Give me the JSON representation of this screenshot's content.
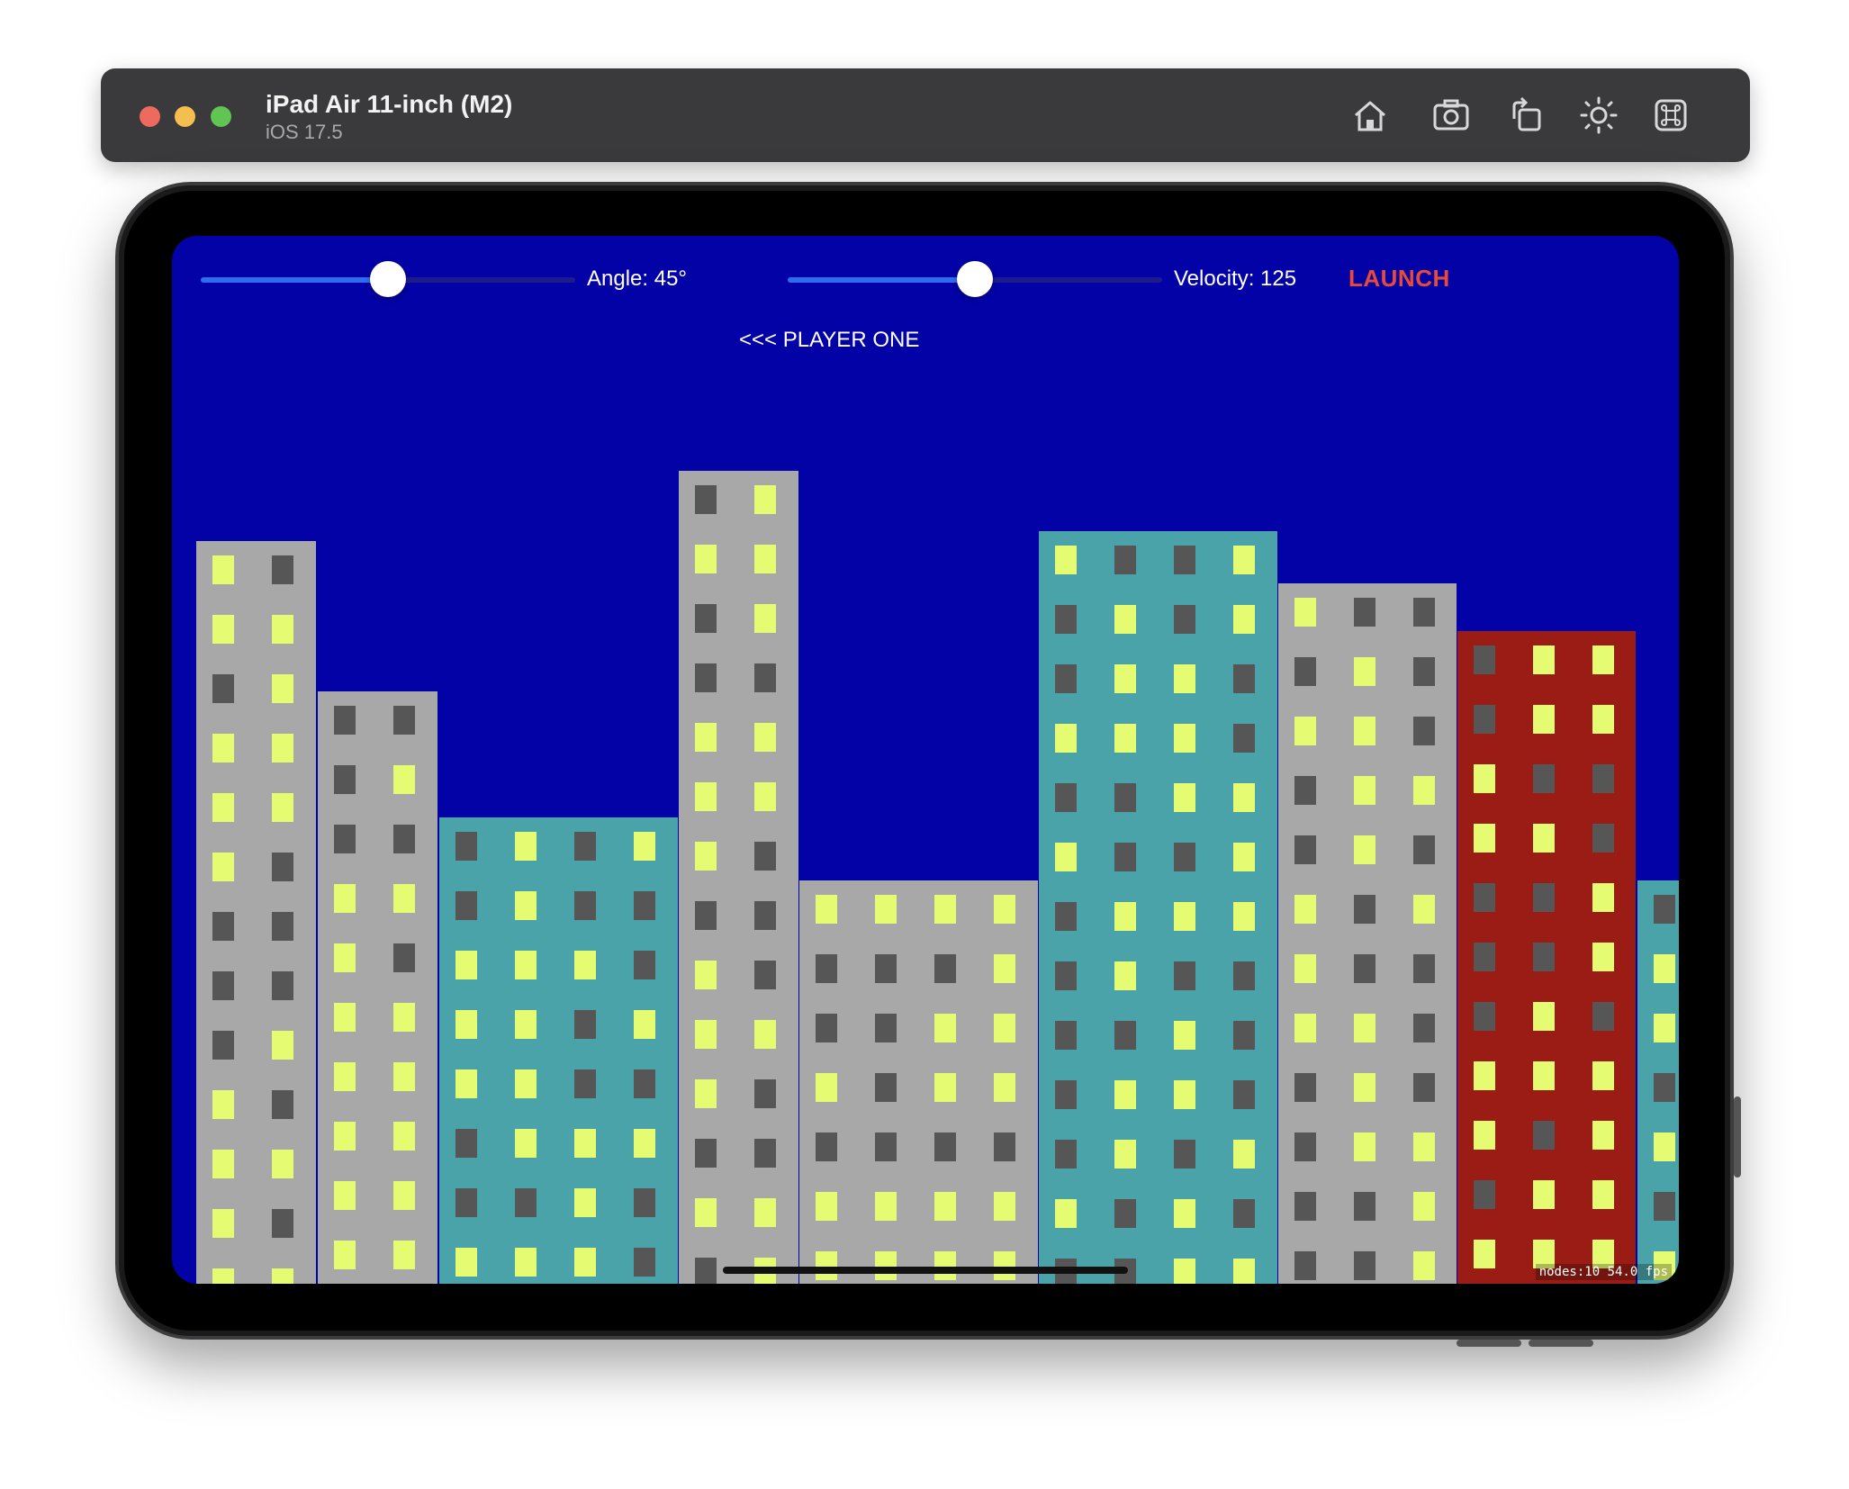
{
  "window": {
    "device_name": "iPad Air 11-inch (M2)",
    "os_version": "iOS 17.5",
    "toolbar": [
      {
        "name": "home-icon"
      },
      {
        "name": "screenshot-icon"
      },
      {
        "name": "rotate-icon"
      },
      {
        "name": "appearance-icon"
      },
      {
        "name": "command-icon"
      }
    ]
  },
  "game": {
    "angle_slider": {
      "label": "Angle: 45°",
      "value": 45,
      "min": 0,
      "max": 90
    },
    "velocity_slider": {
      "label": "Velocity: 125",
      "value": 125,
      "min": 0,
      "max": 250
    },
    "launch_label": "LAUNCH",
    "player_label": "<<< PLAYER ONE",
    "stats": "nodes:10  54.0 fps"
  },
  "colors": {
    "sky": "#0302a6",
    "building_gray": "#a8a8a8",
    "building_teal": "#4aa3a8",
    "building_red": "#9a1c14",
    "window_lit": "#e5fb71",
    "window_dark": "#565656",
    "launch": "#e74a3b"
  }
}
